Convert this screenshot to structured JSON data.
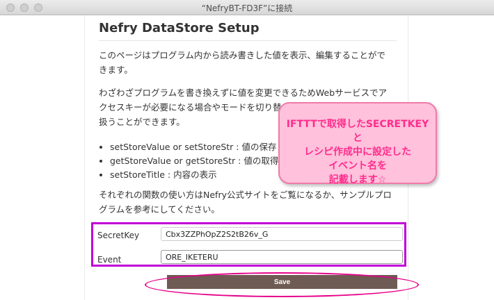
{
  "window": {
    "title": "“NefryBT-FD3F”に接続"
  },
  "page": {
    "heading": "Nefry DataStore Setup",
    "intro_line1": "このページはプログラム内から読み書きした値を表示、編集することがで",
    "intro_line2": "きます。",
    "para2_line1": "わざわざプログラムを書き換えずに値を変更できるためWebサービスでア",
    "para2_line2": "クセスキーが必要になる場合やモードを切り替",
    "para2_line3": "扱うことができます。",
    "bullets": [
      "setStoreValue or setStoreStr : 値の保存",
      "getStoreValue or getStoreStr : 値の取得",
      "setStoreTitle : 内容の表示"
    ],
    "para3_line1": "それぞれの関数の使い方はNefry公式サイトをご覧になるか、サンプルプロ",
    "para3_line2": "グラムを参考にしてください。"
  },
  "form": {
    "fields": [
      {
        "label": "SecretKey",
        "value": "Cbx3ZZPhOpZ2S2tB26v_G"
      },
      {
        "label": "Event",
        "value": "ORE_IKETERU"
      }
    ],
    "save_label": "Save"
  },
  "callout": {
    "line1": "IFTTTで取得したSECRETKEYと",
    "line2": "レシピ作成中に設定した",
    "line3": "イベント名を",
    "line4": "記載します☆"
  },
  "colors": {
    "form_highlight": "#c100d6",
    "save_highlight": "#e6008a",
    "save_button": "#6e5b53",
    "callout_bg": "#ffc1dc",
    "callout_text": "#ff2c8c"
  }
}
